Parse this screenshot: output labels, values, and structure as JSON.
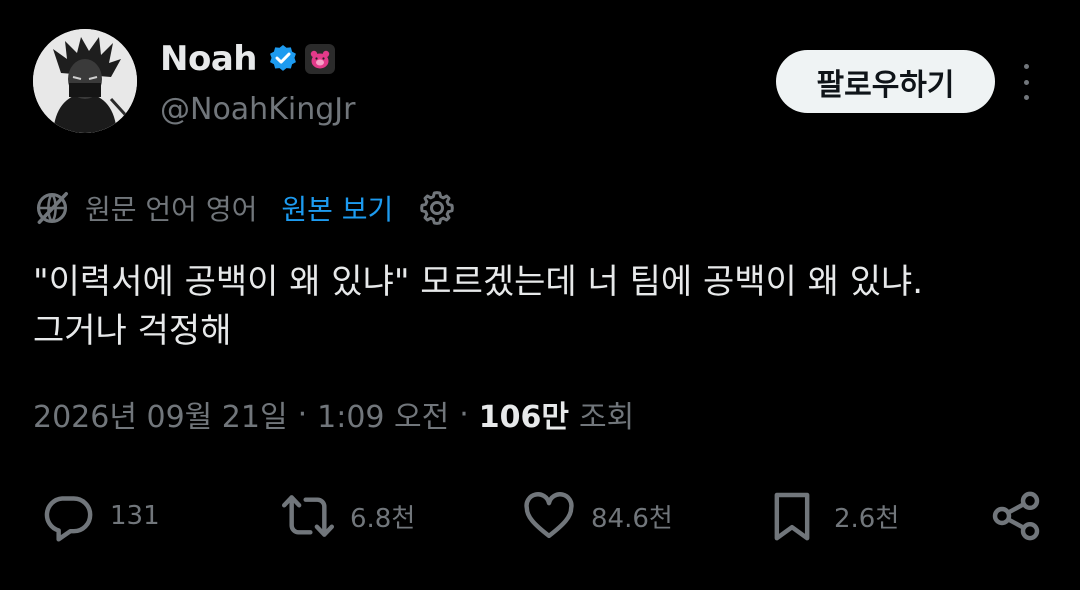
{
  "user": {
    "name": "Noah",
    "handle": "@NoahKingJr",
    "verified_color": "#1d9bf0"
  },
  "header": {
    "follow_label": "팔로우하기",
    "more_icon": "more-vertical-icon"
  },
  "translation": {
    "source_label": "원문 언어 영어",
    "show_original_label": "원본 보기",
    "icon": "no-translate-icon",
    "settings_icon": "gear-icon"
  },
  "tweet": {
    "text": "\"이력서에 공백이 왜 있냐\" 모르겠는데 너 팀에 공백이 왜 있냐.\n그거나 걱정해"
  },
  "meta": {
    "date": "2026년 09월 21일",
    "separator": "·",
    "time": "1:09 오전",
    "views_count": "106만",
    "views_label": "조회"
  },
  "actions": {
    "reply": {
      "icon": "reply-icon",
      "count": "131"
    },
    "retweet": {
      "icon": "retweet-icon",
      "count": "6.8천"
    },
    "like": {
      "icon": "heart-icon",
      "count": "84.6천"
    },
    "bookmark": {
      "icon": "bookmark-icon",
      "count": "2.6천"
    },
    "share": {
      "icon": "share-icon"
    }
  },
  "colors": {
    "background": "#000000",
    "text": "#e7e9ea",
    "secondary": "#71767b",
    "link": "#1d9bf0",
    "affiliate_badge": "#e33a8a"
  }
}
